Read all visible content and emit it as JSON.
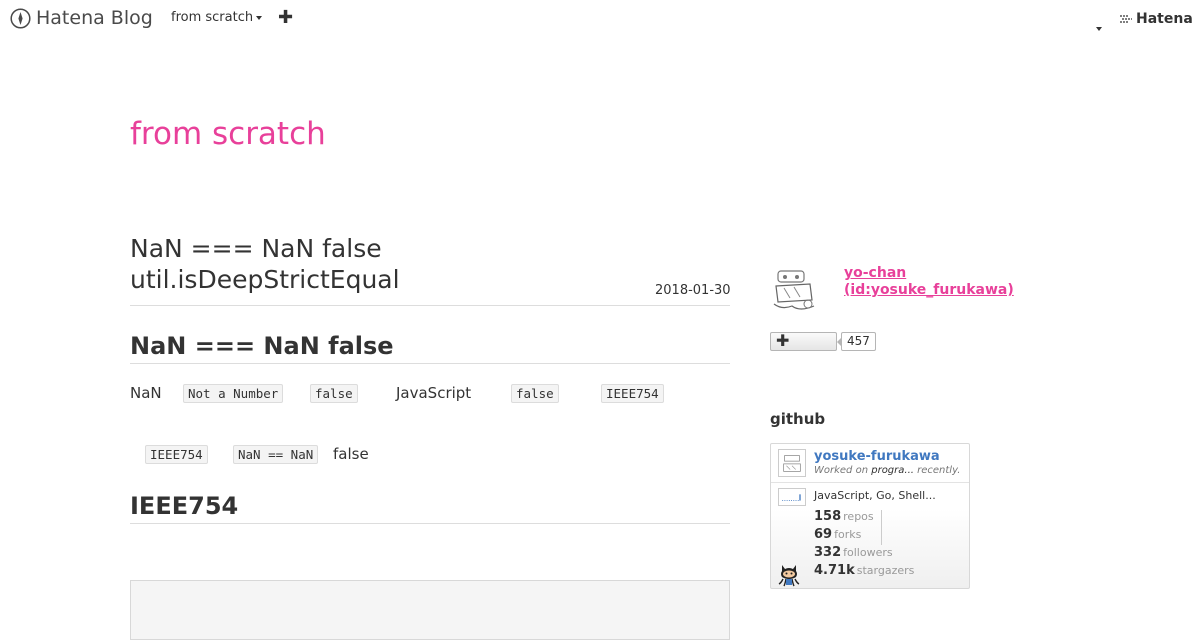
{
  "topbar": {
    "logo_text": "Hatena Blog",
    "blog_switcher_label": "from scratch",
    "add_icon": "plus-icon",
    "hatena_label": "Hatena"
  },
  "blog": {
    "title": "from scratch"
  },
  "entry": {
    "title_line1": "NaN === NaN  false",
    "title_line2": "util.isDeepStrictEqual",
    "date": "2018-01-30",
    "section1_heading": "NaN === NaN  false",
    "para1": {
      "t1": "NaN",
      "c1": "Not a Number",
      "c2": "false",
      "t2": "JavaScript",
      "c3": "false",
      "c4": "IEEE754"
    },
    "para2": {
      "c1": "IEEE754",
      "c2": "NaN == NaN",
      "t1": "false"
    },
    "section2_heading": "IEEE754"
  },
  "sidebar": {
    "profile_name_line1": "yo-chan",
    "profile_name_line2": "(id:yosuke_furukawa)",
    "follow_count": "457",
    "github_title": "github",
    "github": {
      "username": "yosuke-furukawa",
      "worked_prefix": "Worked on ",
      "worked_repo": "progra...",
      "worked_suffix": " recently.",
      "languages": "JavaScript, Go, Shell...",
      "stats": [
        {
          "value": "158",
          "label": "repos"
        },
        {
          "value": "69",
          "label": "forks"
        },
        {
          "value": "332",
          "label": "followers"
        },
        {
          "value": "4.71k",
          "label": "stargazers"
        }
      ]
    }
  },
  "colors": {
    "accent_pink": "#e8409a",
    "github_blue": "#4078c0"
  }
}
